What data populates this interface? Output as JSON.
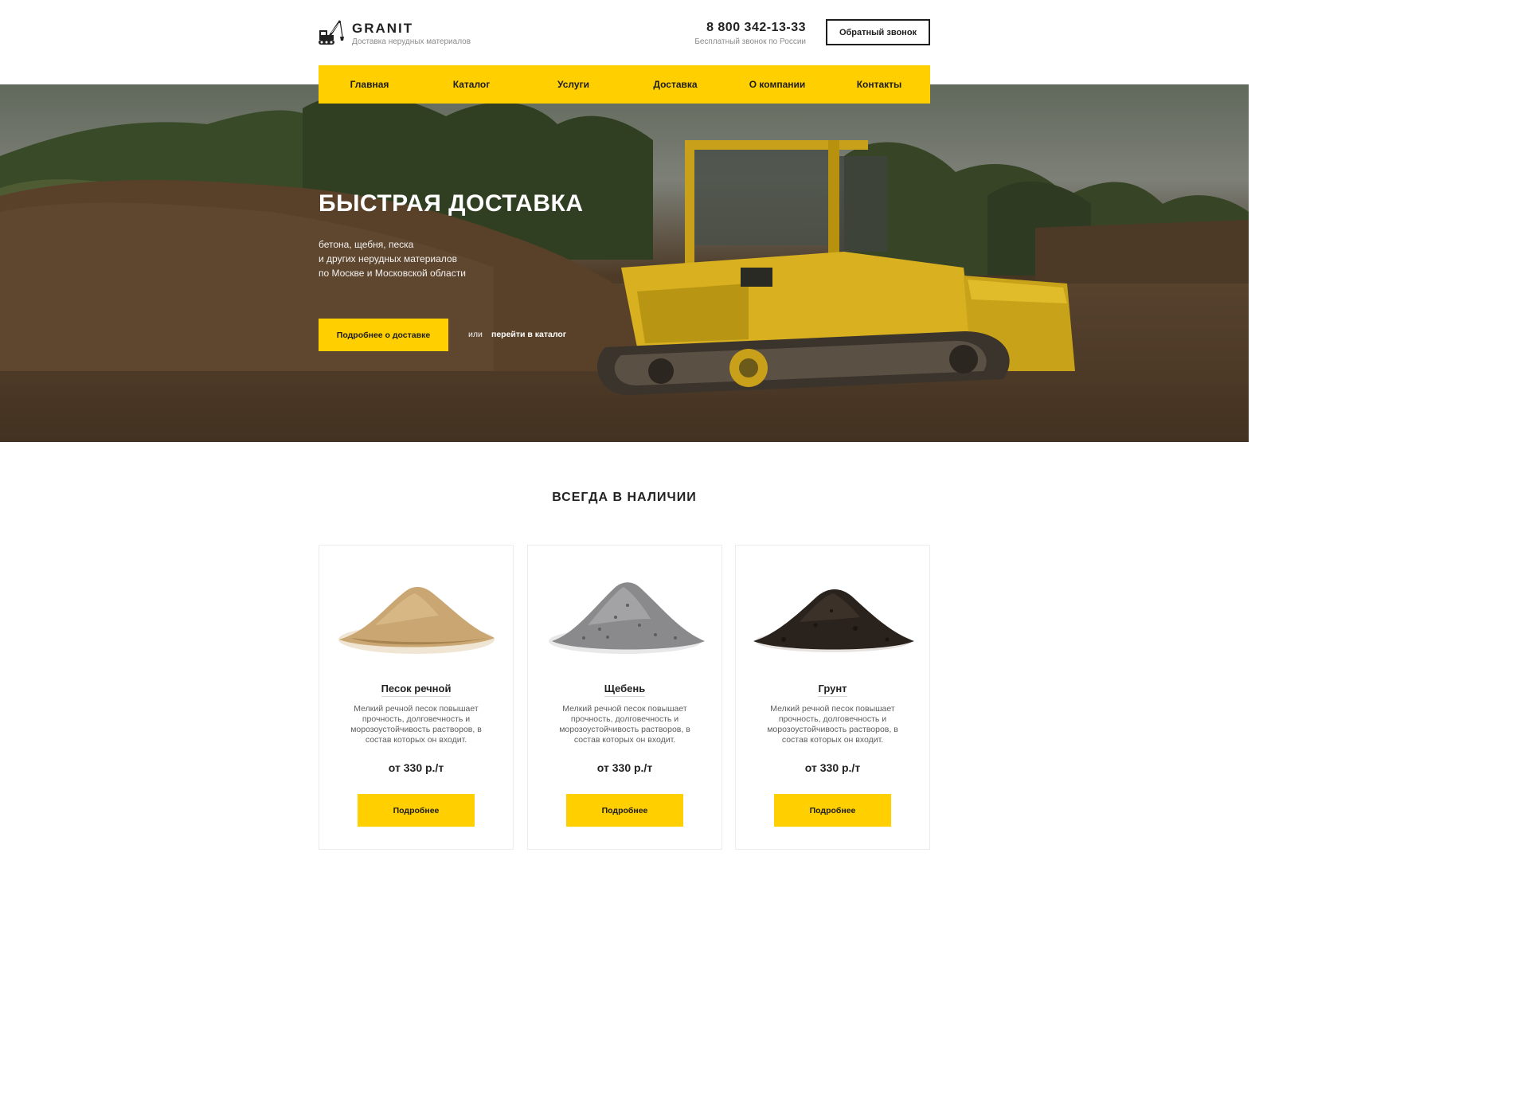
{
  "header": {
    "logo_title": "GRANIT",
    "logo_subtitle": "Доставка нерудных материалов",
    "phone": "8 800 342-13-33",
    "phone_note": "Бесплатный звонок по России",
    "callback_label": "Обратный звонок"
  },
  "nav": {
    "items": [
      {
        "label": "Главная"
      },
      {
        "label": "Каталог"
      },
      {
        "label": "Услуги"
      },
      {
        "label": "Доставка"
      },
      {
        "label": "О компании"
      },
      {
        "label": "Контакты"
      }
    ]
  },
  "hero": {
    "title": "БЫСТРАЯ ДОСТАВКА",
    "lines": [
      "бетона, щебня, песка",
      "и других нерудных материалов",
      "по Москве и Московской области"
    ],
    "button_label": "Подробнее о доставке",
    "or_text": "или",
    "catalog_link": "перейти в каталог"
  },
  "products": {
    "title": "ВСЕГДА В НАЛИЧИИ",
    "items": [
      {
        "name": "Песок речной",
        "description": "Мелкий речной песок повышает прочность, долговечность и морозоустойчивость растворов, в состав которых он входит.",
        "price": "от 330 р./т",
        "button_label": "Подробнее",
        "color": "#c9a672"
      },
      {
        "name": "Щебень",
        "description": "Мелкий речной песок повышает прочность, долговечность и морозоустойчивость растворов, в состав которых он входит.",
        "price": "от 330 р./т",
        "button_label": "Подробнее",
        "color": "#8a8a8c"
      },
      {
        "name": "Грунт",
        "description": "Мелкий речной песок повышает прочность, долговечность и морозоустойчивость растворов, в состав которых он входит.",
        "price": "от 330 р./т",
        "button_label": "Подробнее",
        "color": "#2a221c"
      }
    ]
  },
  "colors": {
    "accent": "#ffcf00",
    "text": "#1d1d1d"
  },
  "icons": {
    "logo": "crane-excavator-icon"
  }
}
